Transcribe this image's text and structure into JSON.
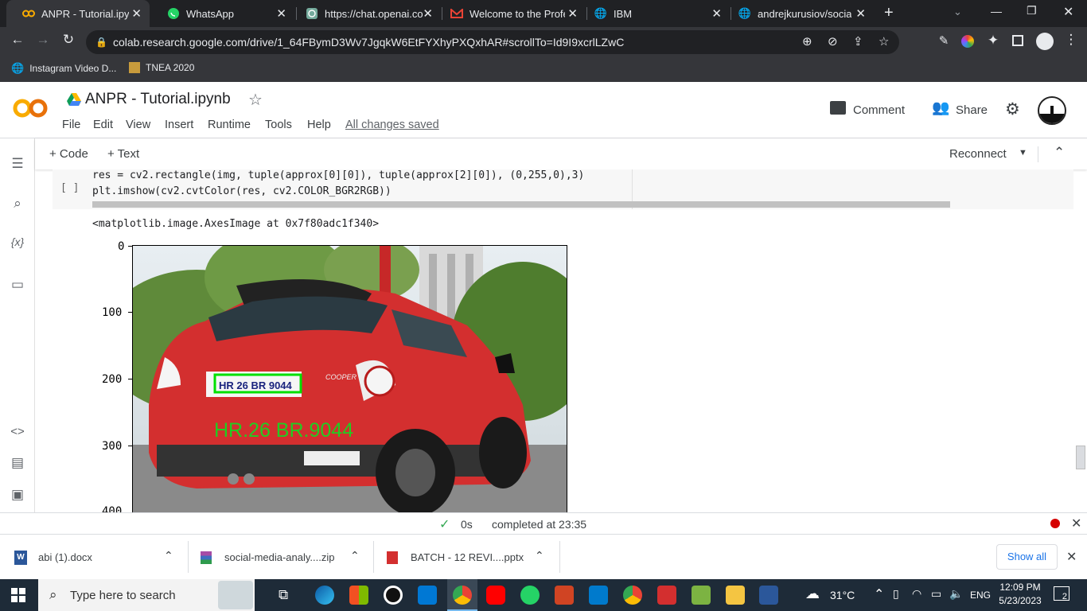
{
  "browser": {
    "tabs": [
      {
        "title": "ANPR - Tutorial.ipynb",
        "active": true
      },
      {
        "title": "WhatsApp",
        "active": false
      },
      {
        "title": "https://chat.openai.co",
        "active": false
      },
      {
        "title": "Welcome to the Profe",
        "active": false
      },
      {
        "title": "IBM",
        "active": false
      },
      {
        "title": "andrejkurusiov/social",
        "active": false
      }
    ],
    "url": "colab.research.google.com/drive/1_64FBymD3Wv7JgqkW6EtFYXhyPXQxhAR#scrollTo=Id9I9xcrlLZwC",
    "bookmarks": [
      "Instagram Video D...",
      "TNEA 2020"
    ]
  },
  "colab": {
    "logo": "CO",
    "title": "ANPR - Tutorial.ipynb",
    "menus": [
      "File",
      "Edit",
      "View",
      "Insert",
      "Runtime",
      "Tools",
      "Help"
    ],
    "save_status": "All changes saved",
    "comment": "Comment",
    "share": "Share",
    "add_code": "+ Code",
    "add_text": "+ Text",
    "reconnect": "Reconnect",
    "cell_bracket": "[ ]",
    "code_line1": "res = cv2.rectangle(img, tuple(approx[0][0]), tuple(approx[2][0]), (0,255,0),3)",
    "code_line2": "plt.imshow(cv2.cvtColor(res, cv2.COLOR_BGR2RGB))",
    "output_text": "<matplotlib.image.AxesImage at 0x7f80adc1f340>",
    "yticks": [
      "0",
      "100",
      "200",
      "300",
      "400"
    ],
    "plate_text": "HR 26 BR 9044",
    "overlay_text": "HR.26 BR.9044",
    "badge_text": "COOPER",
    "status_time": "0s",
    "status_text": "completed at 23:35"
  },
  "downloads": {
    "items": [
      "abi (1).docx",
      "social-media-analy....zip",
      "BATCH - 12 REVI....pptx"
    ],
    "show_all": "Show all"
  },
  "taskbar": {
    "search_placeholder": "Type here to search",
    "weather": "31°C",
    "lang": "ENG",
    "time": "12:09 PM",
    "date": "5/23/2023",
    "notif_count": "2"
  }
}
